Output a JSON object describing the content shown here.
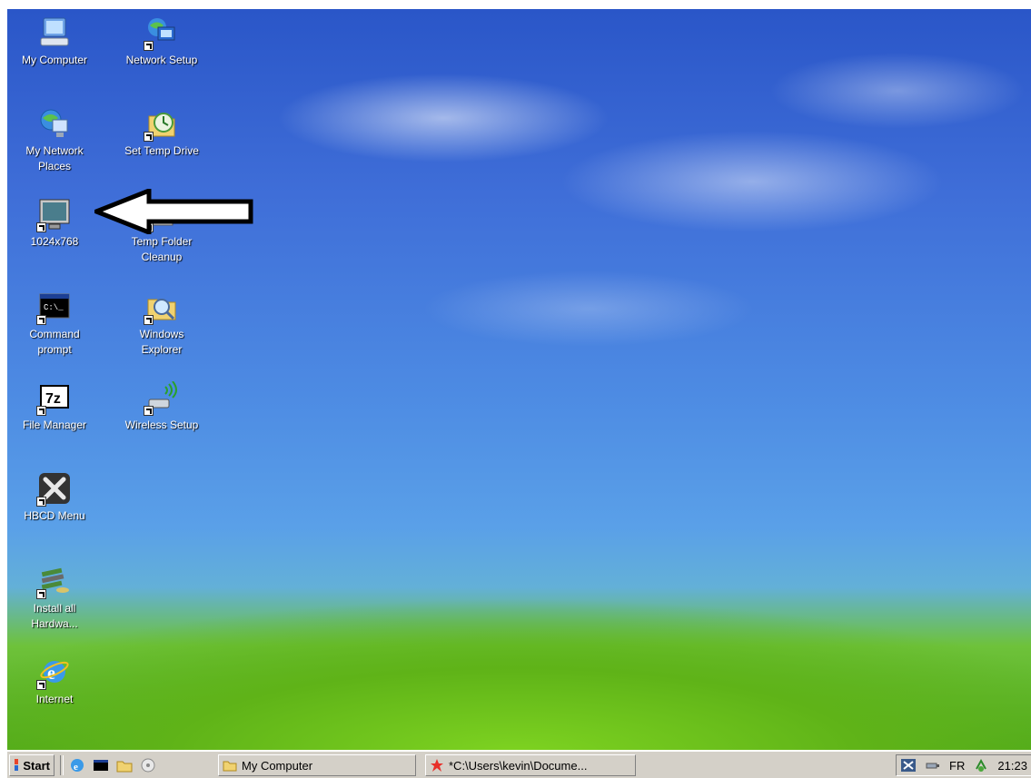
{
  "desktop": {
    "icons": [
      {
        "label": "My Computer",
        "icon": "my-computer-icon"
      },
      {
        "label": "Network Setup",
        "icon": "network-setup-icon"
      },
      {
        "label": "My Network\nPlaces",
        "icon": "network-places-icon"
      },
      {
        "label": "Set Temp Drive",
        "icon": "temp-drive-icon"
      },
      {
        "label": "1024x768",
        "icon": "monitor-icon"
      },
      {
        "label": "Temp Folder\nCleanup",
        "icon": "temp-cleanup-icon"
      },
      {
        "label": "Command\nprompt",
        "icon": "command-prompt-icon"
      },
      {
        "label": "Windows\nExplorer",
        "icon": "explorer-icon"
      },
      {
        "label": "File Manager",
        "icon": "7zip-icon"
      },
      {
        "label": "Wireless Setup",
        "icon": "wireless-icon"
      },
      {
        "label": "HBCD Menu",
        "icon": "tools-icon"
      },
      {
        "label": "Install all\nHardwa...",
        "icon": "hardware-icon"
      },
      {
        "label": "Internet",
        "icon": "internet-explorer-icon"
      }
    ],
    "cmd_glyph_text": "C:\\_",
    "sevenzip_glyph_text": "7z"
  },
  "taskbar": {
    "start_label": "Start",
    "quick_launch": [
      "ie-icon",
      "cmd-icon",
      "folder-icon",
      "media-icon"
    ],
    "tasks": [
      {
        "label": "My Computer",
        "icon": "folder-icon"
      },
      {
        "label": "*C:\\Users\\kevin\\Docume...",
        "icon": "paint-icon"
      }
    ],
    "tray": {
      "lang": "FR",
      "time": "21:23"
    }
  },
  "colors": {
    "taskbar": "#d4d0c8",
    "arrow": "#000000"
  }
}
